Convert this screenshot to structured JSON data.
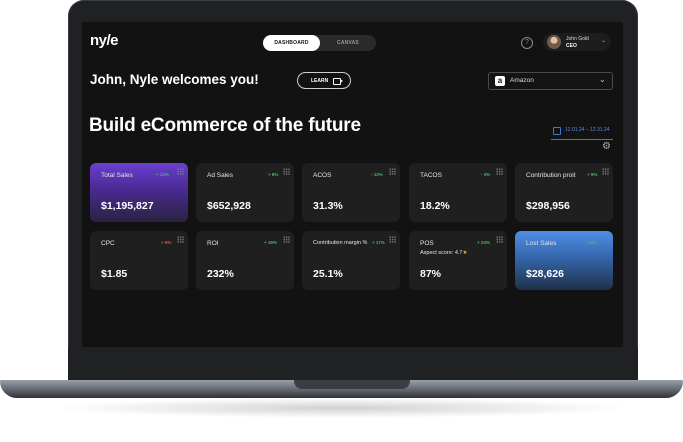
{
  "header": {
    "logo": "ny/e",
    "tabs": [
      {
        "label": "DASHBOARD",
        "active": true
      },
      {
        "label": "CANVAS",
        "active": false
      }
    ],
    "help_icon": "question-circle-icon",
    "user": {
      "name": "John Gold",
      "role": "CEO"
    }
  },
  "welcome": {
    "text": "John, Nyle welcomes you!",
    "learn_label": "LEARN"
  },
  "store_select": {
    "value": "Amazon",
    "icon": "amazon-icon"
  },
  "headline": "Build eCommerce of the future",
  "date_range": "12.01.24 – 12.31.24",
  "cards": [
    {
      "title": "Total Sales",
      "change": "+ 12%",
      "trend": "pos",
      "value": "$1,195,827",
      "style": "purple"
    },
    {
      "title": "Ad Sales",
      "change": "+ 8%",
      "trend": "pos",
      "value": "$652,928",
      "style": "dark"
    },
    {
      "title": "ACOS",
      "change": "- 12%",
      "trend": "pos",
      "value": "31.3%",
      "style": "dark"
    },
    {
      "title": "TACOS",
      "change": "- 3%",
      "trend": "pos",
      "value": "18.2%",
      "style": "dark"
    },
    {
      "title": "Contribution proit",
      "change": "+ 9%",
      "trend": "pos",
      "value": "$298,956",
      "style": "dark"
    },
    {
      "title": "CPC",
      "change": "+ 5%",
      "trend": "neg",
      "value": "$1.85",
      "style": "dark"
    },
    {
      "title": "ROI",
      "change": "+ 19%",
      "trend": "pos",
      "value": "232%",
      "style": "dark"
    },
    {
      "title": "Contribution margin %",
      "change": "+ 17%",
      "trend": "pos",
      "value": "25.1%",
      "style": "dark"
    },
    {
      "title": "POS",
      "change": "+ 24%",
      "trend": "pos",
      "value": "87%",
      "style": "dark",
      "sub": "Aspect score: 4.7"
    },
    {
      "title": "Lost Sales",
      "change": "- 20%",
      "trend": "pos",
      "value": "$28,626",
      "style": "blue"
    }
  ],
  "colors": {
    "accent_purple": "#6a3fd1",
    "accent_blue": "#4f8ee6",
    "positive": "#3fbf5a",
    "negative": "#e0544f"
  }
}
